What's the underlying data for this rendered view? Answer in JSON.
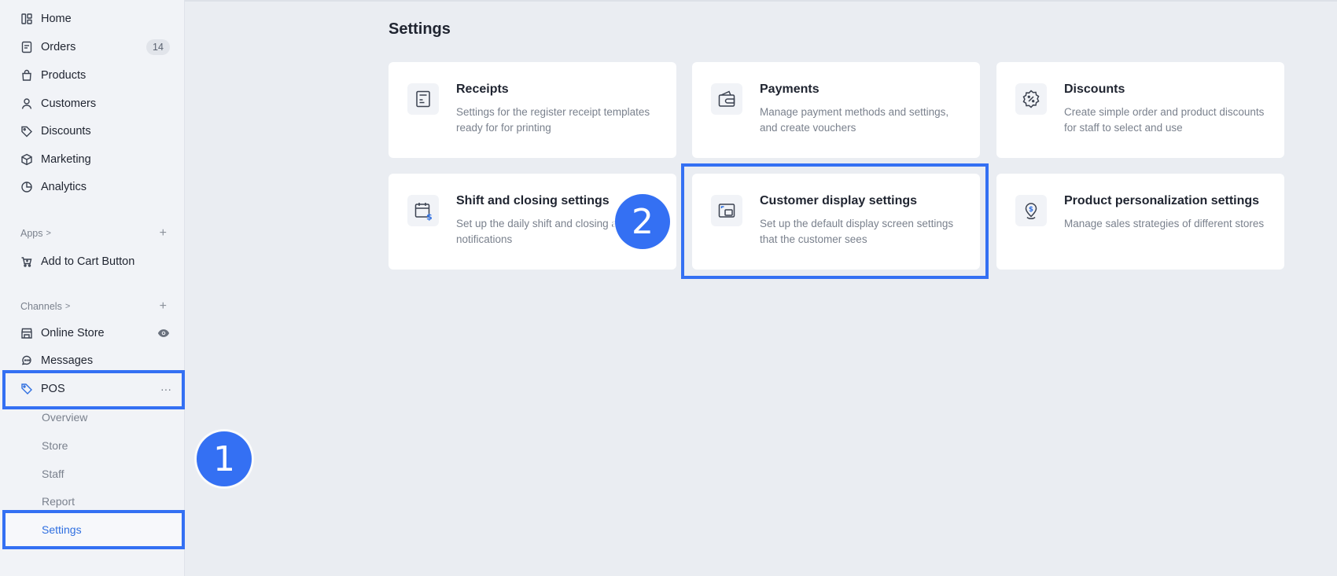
{
  "sidebar": {
    "nav": [
      {
        "label": "Home"
      },
      {
        "label": "Orders",
        "badge": "14"
      },
      {
        "label": "Products"
      },
      {
        "label": "Customers"
      },
      {
        "label": "Discounts"
      },
      {
        "label": "Marketing"
      },
      {
        "label": "Analytics"
      }
    ],
    "apps": {
      "heading": "Apps",
      "chevron": ">",
      "add": "+",
      "items": [
        {
          "label": "Add to Cart Button"
        }
      ]
    },
    "channels": {
      "heading": "Channels",
      "chevron": ">",
      "add": "+",
      "items": [
        {
          "label": "Online Store"
        },
        {
          "label": "Messages"
        },
        {
          "label": "POS",
          "more": "···"
        }
      ],
      "pos_subitems": [
        {
          "label": "Overview"
        },
        {
          "label": "Store"
        },
        {
          "label": "Staff"
        },
        {
          "label": "Report"
        },
        {
          "label": "Settings"
        }
      ]
    }
  },
  "main": {
    "title": "Settings",
    "cards": [
      {
        "title": "Receipts",
        "desc": "Settings for the register receipt templates ready for for printing"
      },
      {
        "title": "Payments",
        "desc": "Manage payment methods and settings, and create vouchers"
      },
      {
        "title": "Discounts",
        "desc": "Create simple order and product discounts for staff to select and use"
      },
      {
        "title": "Shift and closing settings",
        "desc": "Set up the daily shift and closing and notifications"
      },
      {
        "title": "Customer display settings",
        "desc": "Set up the default display screen settings that the customer sees"
      },
      {
        "title": "Product personalization settings",
        "desc": "Manage sales strategies of different stores"
      }
    ]
  },
  "annotations": {
    "step1": "1",
    "step2": "2"
  },
  "colors": {
    "accent": "#3470f3",
    "active_text": "#2f6fe0",
    "background": "#eaedf2"
  }
}
